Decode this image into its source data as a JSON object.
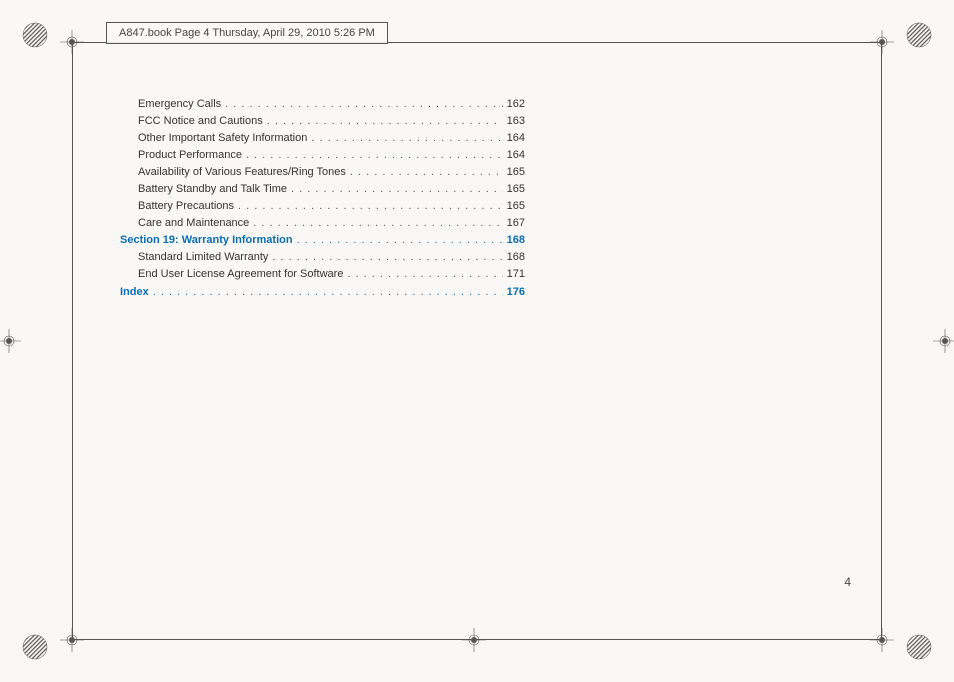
{
  "header": "A847.book  Page 4  Thursday, April 29, 2010  5:26 PM",
  "toc": [
    {
      "label": "Emergency Calls",
      "page": "162",
      "type": "sub"
    },
    {
      "label": "FCC Notice and Cautions",
      "page": "163",
      "type": "sub"
    },
    {
      "label": "Other Important Safety Information",
      "page": "164",
      "type": "sub"
    },
    {
      "label": "Product Performance",
      "page": "164",
      "type": "sub"
    },
    {
      "label": "Availability of Various Features/Ring Tones",
      "page": "165",
      "type": "sub"
    },
    {
      "label": "Battery Standby and Talk Time",
      "page": "165",
      "type": "sub"
    },
    {
      "label": "Battery Precautions",
      "page": "165",
      "type": "sub"
    },
    {
      "label": "Care and Maintenance",
      "page": "167",
      "type": "sub"
    },
    {
      "label": "Section 19:  Warranty Information",
      "page": "168",
      "type": "section"
    },
    {
      "label": "Standard Limited Warranty",
      "page": "168",
      "type": "sub"
    },
    {
      "label": "End User License Agreement for Software",
      "page": "171",
      "type": "sub"
    },
    {
      "label": "Index",
      "page": "176",
      "type": "section"
    }
  ],
  "page_number": "4",
  "dots": ". . . . . . . . . . . . . . . . . . . . . . . . . . . . . . . . . . . . . . . . . . . . . . . . . . . . . . . . . . . . . . . . . . . . . . . . . . . . . . . ."
}
